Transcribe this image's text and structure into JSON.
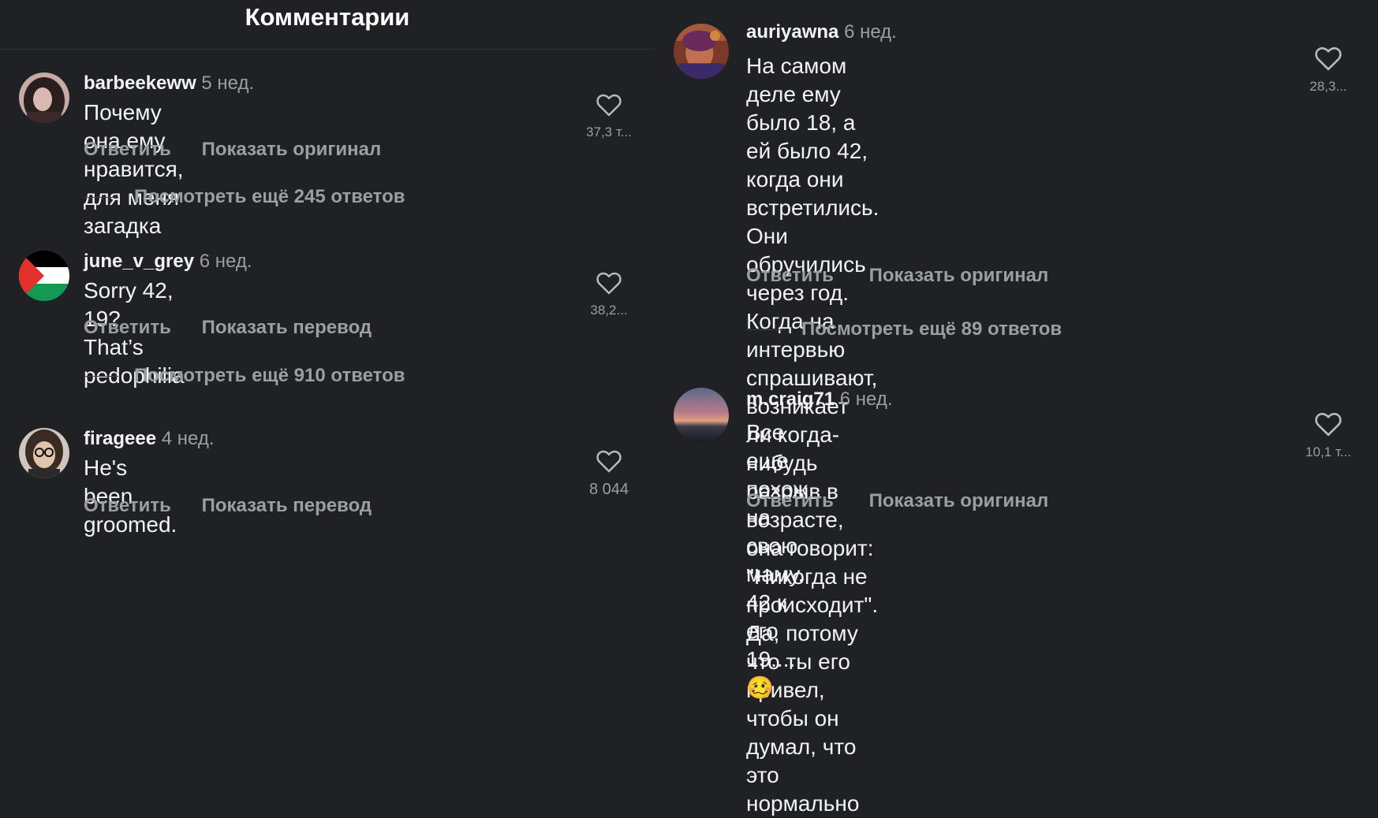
{
  "header": {
    "title": "Комментарии"
  },
  "labels": {
    "reply": "Ответить"
  },
  "colors": {
    "background": "#1f2125",
    "primary_text": "#f2f3f5",
    "secondary_text": "#9a9ea5"
  },
  "left_comments": [
    {
      "username": "barbeekeww",
      "time": "5 нед.",
      "text": "Почему она ему нравится, для меня загадка",
      "secondary_action": "Показать оригинал",
      "likes": "37,3 т...",
      "replies": "Посмотреть ещё 245 ответов",
      "avatar": "dark-hair-portrait"
    },
    {
      "username": "june_v_grey",
      "time": "6 нед.",
      "text": "Sorry 42, 19? That’s pedophilia",
      "secondary_action": "Показать перевод",
      "likes": "38,2...",
      "replies": "Посмотреть ещё 910 ответов",
      "avatar": "palestine-flag"
    },
    {
      "username": "firageee",
      "time": "4 нед.",
      "text": "He's been groomed.",
      "secondary_action": "Показать перевод",
      "likes": "8 044",
      "avatar": "glasses-portrait"
    }
  ],
  "right_comments": [
    {
      "username": "auriyawna",
      "time": "6 нед.",
      "lines": [
        "На самом деле ему было 18, а ей было 42,",
        "когда они встретились. Они обручились",
        "через год. Когда на интервью спрашивают,",
        "возникает ли когда-нибудь разрыв в",
        "возрасте, она говорит: \"Никогда не",
        "происходит\". Да, потому что ты его привел,",
        "чтобы он думал, что это нормально"
      ],
      "secondary_action": "Показать оригинал",
      "likes": "28,3...",
      "replies": "Посмотреть ещё 89 ответов",
      "avatar": "colorful-portrait"
    },
    {
      "username": "m.craig71",
      "time": "6 нед.",
      "lines": [
        "Все еще похож на свою маму. 42 к его 19....",
        "🥴"
      ],
      "secondary_action": "Показать оригинал",
      "likes": "10,1 т...",
      "avatar": "sunset-landscape"
    }
  ]
}
